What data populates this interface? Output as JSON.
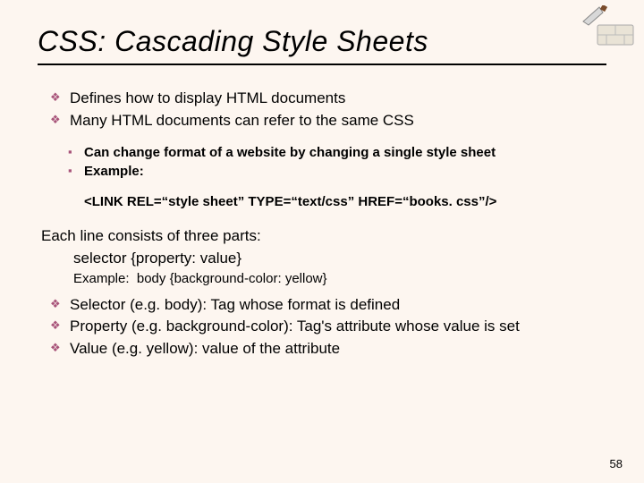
{
  "title": "CSS: Cascading Style Sheets",
  "bullets1": {
    "b0": "Defines how to display HTML documents",
    "b1": "Many HTML documents can refer to the same CSS"
  },
  "sub1": {
    "s0": "Can change format of a website by changing a single style sheet",
    "s1": "Example:",
    "s1_cont": "<LINK REL=“style sheet” TYPE=“text/css” HREF=“books. css”/>"
  },
  "mid": {
    "line0": "Each line consists of three parts:",
    "line1": "selector {property: value}",
    "example_label": "Example:",
    "example_code": "body {background-color: yellow}"
  },
  "bullets2": {
    "b0": "Selector (e.g. body): Tag whose format is defined",
    "b1": "Property (e.g. background-color): Tag's attribute whose value is set",
    "b2": "Value (e.g. yellow): value of the attribute"
  },
  "page_number": "58"
}
